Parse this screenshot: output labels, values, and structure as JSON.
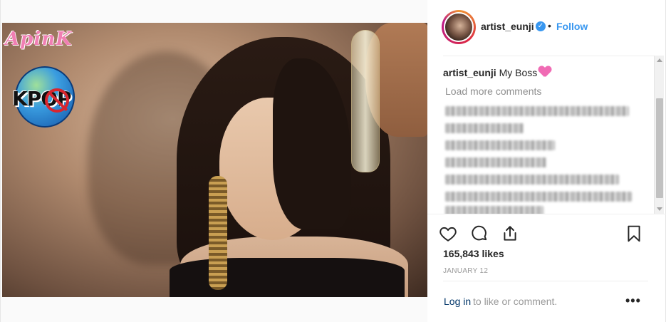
{
  "post": {
    "username": "artist_eunji",
    "follow_label": "Follow",
    "separator": "•",
    "verified_glyph": "✓",
    "caption_user": "artist_eunji",
    "caption_text": "My Boss",
    "caption_emoji": "pink-heart-emoji",
    "load_more": "Load more comments",
    "likes": "165,843 likes",
    "date": "JANUARY 12",
    "login_link": "Log in",
    "login_rest": "to like or comment.",
    "more_options": "•••"
  },
  "watermarks": {
    "apink": "ApinK",
    "kpop": "KPOP"
  },
  "icons": {
    "like": "heart-outline-icon",
    "comment": "speech-bubble-icon",
    "share": "share-upload-icon",
    "save": "bookmark-icon"
  },
  "colors": {
    "link_blue": "#3897f0",
    "text": "#262626",
    "muted": "#8e8e8e",
    "border": "#efefef"
  }
}
